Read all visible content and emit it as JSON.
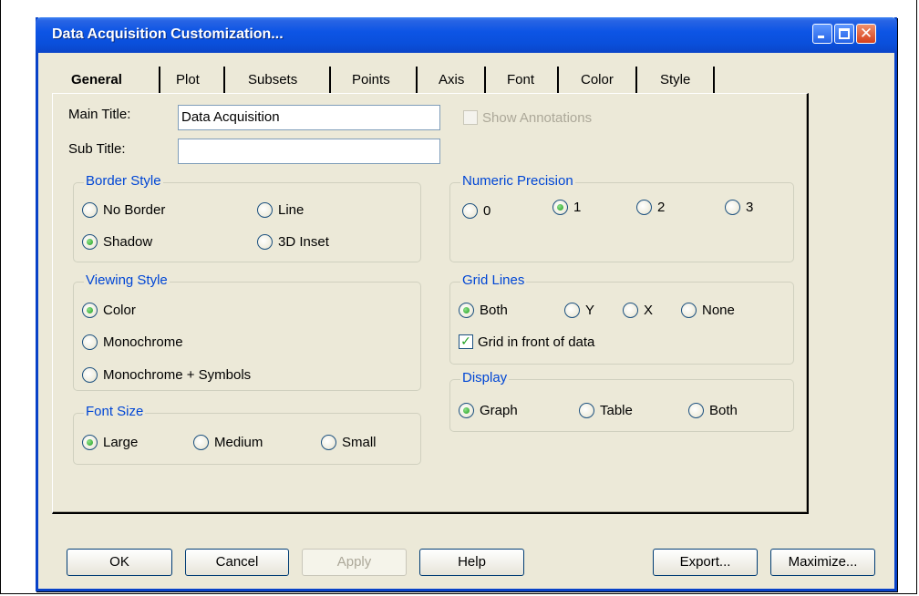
{
  "window": {
    "title": "Data Acquisition Customization...",
    "controls": {
      "minimize": "minimize-icon",
      "maximize": "maximize-icon",
      "close": "close-icon"
    }
  },
  "tabs": [
    {
      "label": "General",
      "active": true
    },
    {
      "label": "Plot",
      "active": false
    },
    {
      "label": "Subsets",
      "active": false
    },
    {
      "label": "Points",
      "active": false
    },
    {
      "label": "Axis",
      "active": false
    },
    {
      "label": "Font",
      "active": false
    },
    {
      "label": "Color",
      "active": false
    },
    {
      "label": "Style",
      "active": false
    }
  ],
  "general": {
    "main_title_label": "Main Title:",
    "main_title_value": "Data Acquisition",
    "sub_title_label": "Sub Title:",
    "sub_title_value": "",
    "show_annotations": {
      "label": "Show Annotations",
      "checked": false,
      "enabled": false
    }
  },
  "border_style": {
    "title": "Border Style",
    "options": [
      "No Border",
      "Line",
      "Shadow",
      "3D Inset"
    ],
    "selected": "Shadow"
  },
  "viewing_style": {
    "title": "Viewing Style",
    "options": [
      "Color",
      "Monochrome",
      "Monochrome + Symbols"
    ],
    "selected": "Color"
  },
  "font_size": {
    "title": "Font Size",
    "options": [
      "Large",
      "Medium",
      "Small"
    ],
    "selected": "Large"
  },
  "numeric_precision": {
    "title": "Numeric Precision",
    "options": [
      "0",
      "1",
      "2",
      "3"
    ],
    "selected": "1"
  },
  "grid_lines": {
    "title": "Grid Lines",
    "options": [
      "Both",
      "Y",
      "X",
      "None"
    ],
    "selected": "Both",
    "grid_in_front": {
      "label": "Grid in front of data",
      "checked": true
    }
  },
  "display": {
    "title": "Display",
    "options": [
      "Graph",
      "Table",
      "Both"
    ],
    "selected": "Graph"
  },
  "buttons": {
    "ok": "OK",
    "cancel": "Cancel",
    "apply": "Apply",
    "help": "Help",
    "export": "Export...",
    "maximize": "Maximize..."
  },
  "colors": {
    "titlebar": "#0a4fdb",
    "group_title": "#0046d5",
    "dialog_bg": "#ece9d8",
    "radio_selected": "#21a121"
  }
}
